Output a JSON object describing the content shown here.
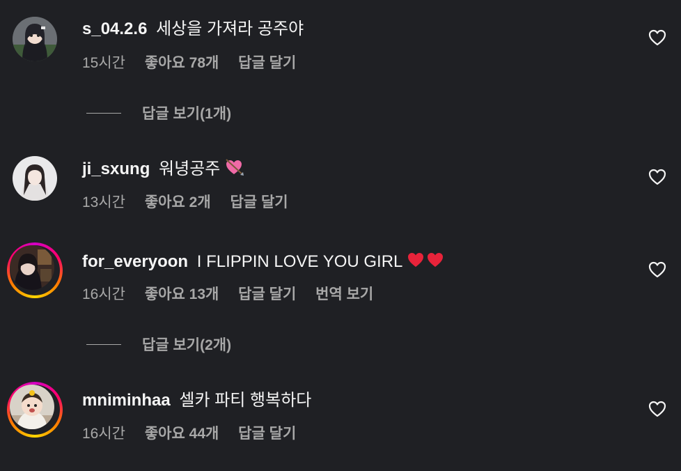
{
  "comments": [
    {
      "username": "s_04.2.6",
      "text": "세상을 가져라 공주야",
      "time": "15시간",
      "likes": "좋아요 78개",
      "reply": "답글 달기",
      "view_replies": "답글 보기(1개)"
    },
    {
      "username": "ji_sxung",
      "text": "워녕공주",
      "time": "13시간",
      "likes": "좋아요 2개",
      "reply": "답글 달기"
    },
    {
      "username": "for_everyoon",
      "text": "I FLIPPIN LOVE YOU GIRL",
      "time": "16시간",
      "likes": "좋아요 13개",
      "reply": "답글 달기",
      "translate": "번역 보기",
      "view_replies": "답글 보기(2개)"
    },
    {
      "username": "mniminhaa",
      "text": "셀카 파티 행복하다",
      "time": "16시간",
      "likes": "좋아요 44개",
      "reply": "답글 달기"
    }
  ],
  "colors": {
    "background": "#1f2024",
    "text": "#f5f5f5",
    "muted": "#a8a8a8",
    "story_ring": "#ff0069"
  }
}
